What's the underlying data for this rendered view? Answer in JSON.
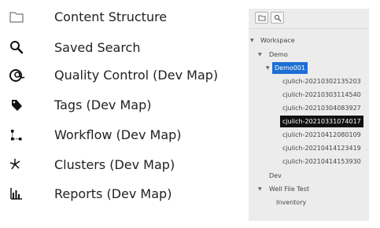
{
  "menu": {
    "items": [
      {
        "label": "Content Structure",
        "icon": "folder-icon"
      },
      {
        "label": "Saved Search",
        "icon": "search-icon"
      },
      {
        "label": "Quality Control (Dev Map)",
        "icon": "quality-control-icon"
      },
      {
        "label": "Tags (Dev Map)",
        "icon": "tag-icon"
      },
      {
        "label": "Workflow (Dev Map)",
        "icon": "workflow-icon"
      },
      {
        "label": "Clusters (Dev Map)",
        "icon": "clusters-icon"
      },
      {
        "label": "Reports (Dev Map)",
        "icon": "bar-chart-icon"
      }
    ]
  },
  "tree_panel": {
    "toolbar": [
      {
        "icon": "folder-icon"
      },
      {
        "icon": "search-icon"
      }
    ],
    "nodes": {
      "workspace": "Workspace",
      "demo": "Demo",
      "demo001": "Demo001",
      "children": [
        "cjulich-20210302135203",
        "cjulich-20210303114540",
        "cjulich-20210304083927",
        "cjulich-20210331074017",
        "cjulich-20210412080109",
        "cjulich-20210414123419",
        "cjulich-20210414153930"
      ],
      "dev": "Dev",
      "well_file_test": "Well File Test",
      "inventory": "Inventory"
    },
    "carets": {
      "expanded": "▼"
    },
    "colors": {
      "selected": "#1d6fd6",
      "highlighted": "#111111",
      "panel_bg": "#ececec"
    }
  }
}
